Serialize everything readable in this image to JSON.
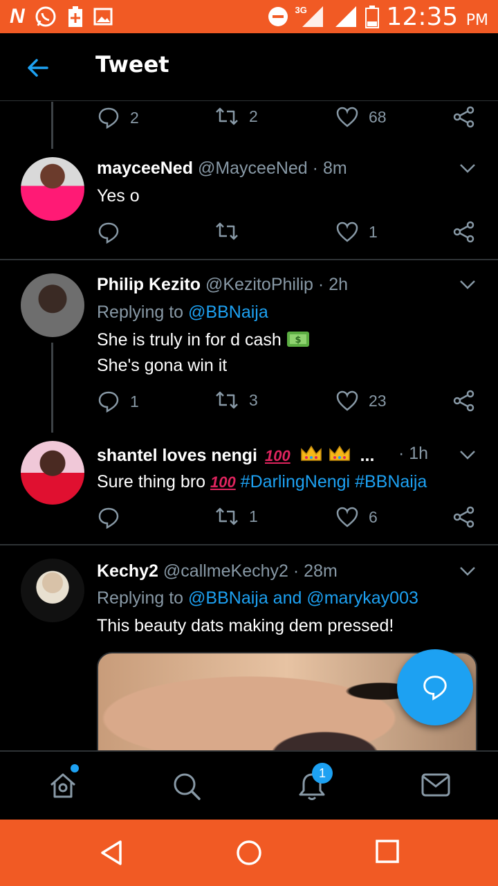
{
  "status_bar": {
    "carrier_icon": "N",
    "icons": [
      "whatsapp-icon",
      "battery-plus-icon",
      "image-icon"
    ],
    "network": "3G",
    "time": "12:35",
    "ampm": "PM"
  },
  "header": {
    "title": "Tweet"
  },
  "top_actions": {
    "reply_count": "2",
    "retweet_count": "2",
    "like_count": "68"
  },
  "tweets": [
    {
      "display_name": "mayceeNed",
      "handle": "@MayceeNed",
      "time": "· 8m",
      "text": "Yes o",
      "reply_count": "",
      "retweet_count": "",
      "like_count": "1"
    },
    {
      "display_name": "Philip Kezito",
      "handle": "@KezitoPhilip",
      "time": "· 2h",
      "replying_prefix": "Replying to",
      "replying_to": "@BBNaija",
      "text_line1": "She is truly in for d cash",
      "text_line2": "She's gona win it",
      "reply_count": "1",
      "retweet_count": "3",
      "like_count": "23"
    },
    {
      "display_name": "shantel loves nengi",
      "name_ellipsis": "...",
      "time": "· 1h",
      "text_prefix": "Sure thing bro",
      "hashtag1": "#DarlingNengi",
      "hashtag2": "#BBNaija",
      "reply_count": "",
      "retweet_count": "1",
      "like_count": "6"
    },
    {
      "display_name": "Kechy2",
      "handle": "@callmeKechy2",
      "time": "· 28m",
      "replying_prefix": "Replying to",
      "replying_to": "@BBNaija and @marykay003",
      "text": "This beauty dats making dem pressed!"
    }
  ],
  "tabs": [
    "home-icon",
    "search-icon",
    "notifications-icon",
    "messages-icon"
  ],
  "notifications_badge": "1",
  "colors": {
    "accent": "#1da1f2",
    "status_bar": "#f15a24",
    "muted": "#8899a6"
  }
}
